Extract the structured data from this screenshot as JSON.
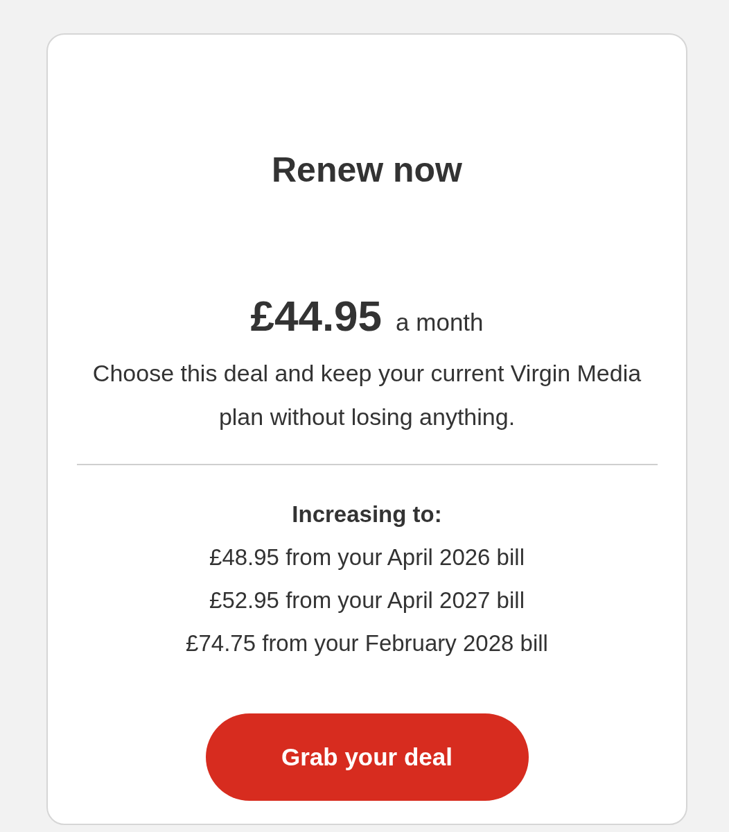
{
  "card": {
    "title": "Renew now",
    "price": {
      "amount": "£44.95",
      "period": "a month"
    },
    "description": "Choose this deal and keep your current Virgin Media plan without losing anything.",
    "increase_heading": "Increasing to:",
    "increases": [
      "£48.95 from your April 2026 bill",
      "£52.95 from your April 2027 bill",
      "£74.75 from your February 2028 bill"
    ],
    "button": "Grab your deal"
  }
}
